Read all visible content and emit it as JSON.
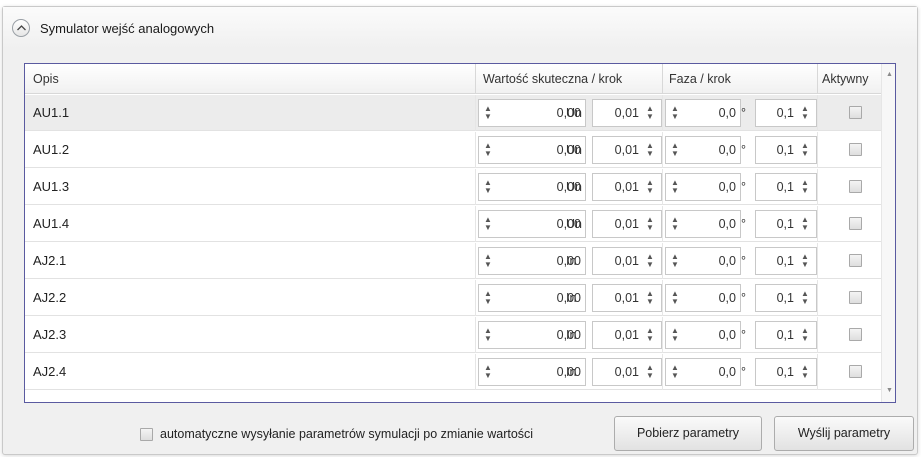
{
  "panel": {
    "title": "Symulator wejść analogowych",
    "collapse_icon": "chevron-up-icon"
  },
  "grid": {
    "headers": {
      "opis": "Opis",
      "wartosc": "Wartość skuteczna / krok",
      "faza": "Faza / krok",
      "aktywny": "Aktywny"
    },
    "rows": [
      {
        "name": "AU1.1",
        "value": "0,00",
        "unit": "Un",
        "value_step": "0,01",
        "phase": "0,0",
        "phase_unit": "°",
        "phase_step": "0,1",
        "active": false
      },
      {
        "name": "AU1.2",
        "value": "0,00",
        "unit": "Un",
        "value_step": "0,01",
        "phase": "0,0",
        "phase_unit": "°",
        "phase_step": "0,1",
        "active": false
      },
      {
        "name": "AU1.3",
        "value": "0,00",
        "unit": "Un",
        "value_step": "0,01",
        "phase": "0,0",
        "phase_unit": "°",
        "phase_step": "0,1",
        "active": false
      },
      {
        "name": "AU1.4",
        "value": "0,00",
        "unit": "Un",
        "value_step": "0,01",
        "phase": "0,0",
        "phase_unit": "°",
        "phase_step": "0,1",
        "active": false
      },
      {
        "name": "AJ2.1",
        "value": "0,00",
        "unit": "In",
        "value_step": "0,01",
        "phase": "0,0",
        "phase_unit": "°",
        "phase_step": "0,1",
        "active": false
      },
      {
        "name": "AJ2.2",
        "value": "0,00",
        "unit": "In",
        "value_step": "0,01",
        "phase": "0,0",
        "phase_unit": "°",
        "phase_step": "0,1",
        "active": false
      },
      {
        "name": "AJ2.3",
        "value": "0,00",
        "unit": "In",
        "value_step": "0,01",
        "phase": "0,0",
        "phase_unit": "°",
        "phase_step": "0,1",
        "active": false
      },
      {
        "name": "AJ2.4",
        "value": "0,00",
        "unit": "In",
        "value_step": "0,01",
        "phase": "0,0",
        "phase_unit": "°",
        "phase_step": "0,1",
        "active": false
      }
    ]
  },
  "footer": {
    "auto_send_label": "automatyczne wysyłanie parametrów symulacji po zmianie wartości",
    "auto_send_checked": false,
    "fetch_button": "Pobierz parametry",
    "send_button": "Wyślij parametry"
  }
}
